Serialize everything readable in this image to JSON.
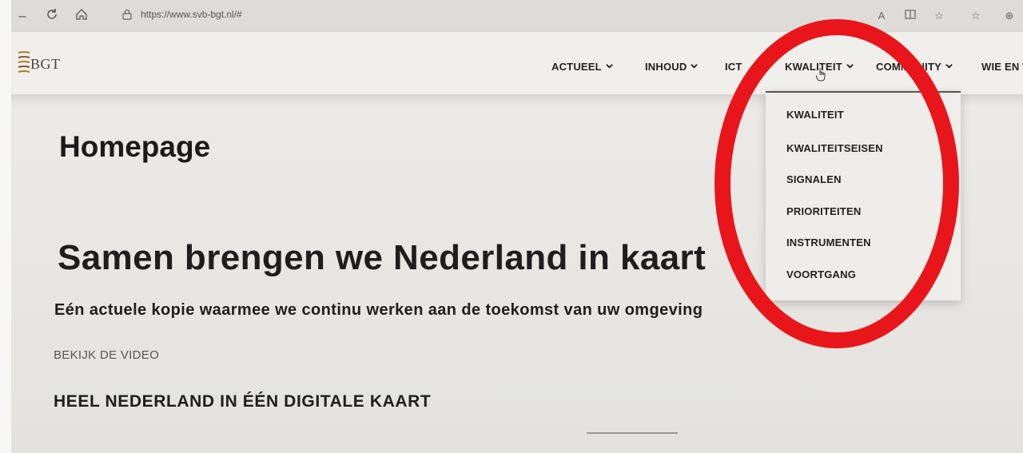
{
  "browser": {
    "url": "https://www.svb-bgt.nl/#",
    "icons": [
      "back-icon",
      "refresh-icon",
      "home-icon",
      "lock-icon",
      "read-aloud-icon",
      "reader-view-icon",
      "favorite-icon",
      "favorites-list-icon",
      "collections-icon"
    ]
  },
  "site": {
    "logo_left_letter": "B",
    "logo_text": "BGT",
    "menu": [
      {
        "label": "ACTUEEL"
      },
      {
        "label": "INHOUD"
      },
      {
        "label": "ICT"
      },
      {
        "label": "KWALITEIT"
      },
      {
        "label": "COMMUNITY"
      },
      {
        "label": "WIE EN W"
      }
    ]
  },
  "dropdown": {
    "items": [
      "KWALITEIT",
      "KWALITEITSEISEN",
      "SIGNALEN",
      "PRIORITEITEN",
      "INSTRUMENTEN",
      "VOORTGANG"
    ]
  },
  "page": {
    "title": "Homepage",
    "hero_heading": "Samen brengen we Nederland in kaart",
    "hero_subheading": "Eén actuele kopie waarmee we continu werken aan de toekomst van uw omgeving",
    "video_link": "BEKIJK DE VIDEO",
    "section_heading": "HEEL NEDERLAND IN ÉÉN DIGITALE KAART"
  },
  "colors": {
    "annotation_circle": "#e8161b",
    "background": "#e9e8e4",
    "text": "#1b1b1b"
  }
}
